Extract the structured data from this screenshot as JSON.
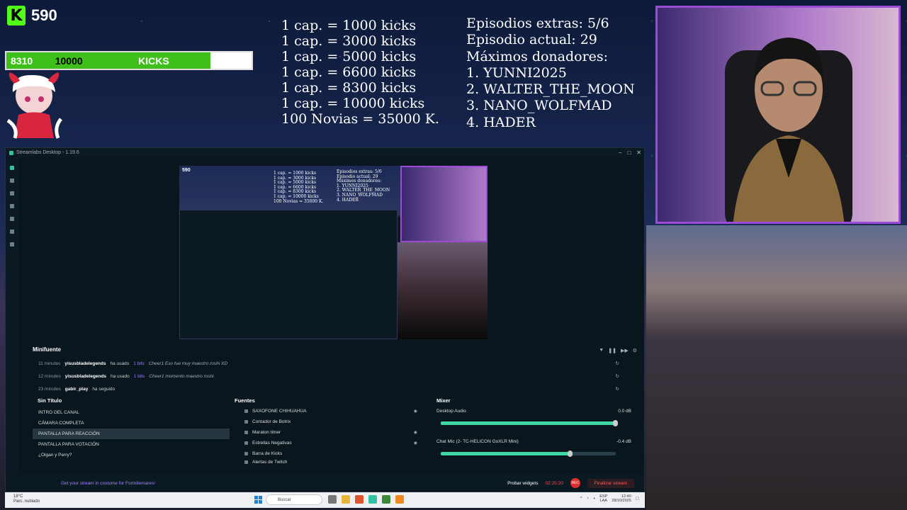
{
  "overlay": {
    "kick_count": "590",
    "kicks_bar": {
      "current": "8310",
      "label": "KICKS",
      "goal": "10000",
      "progress": 0.831
    },
    "rates": [
      "1 cap. = 1000 kicks",
      "1 cap. = 3000 kicks",
      "1 cap. = 5000 kicks",
      "1 cap. = 6600 kicks",
      "1 cap. = 8300 kicks",
      "1 cap. = 10000 kicks",
      "100 Novias = 35000 K."
    ],
    "episodes": [
      "Episodios extras: 5/6",
      "Episodio actual: 29",
      "Máximos donadores:",
      "1. YUNNI2025",
      "2. WALTER_THE_MOON",
      "3. NANO_WOLFMAD",
      "4. HADER"
    ]
  },
  "window": {
    "title": "Streamlabs Desktop - 1.19.6"
  },
  "preview": {
    "kick_count": "590",
    "rates": [
      "1 cap. = 1000 kicks",
      "1 cap. = 3000 kicks",
      "1 cap. = 5000 kicks",
      "1 cap. = 6600 kicks",
      "1 cap. = 8300 kicks",
      "1 cap. = 10000 kicks",
      "100 Novias = 35000 K."
    ],
    "episodes": [
      "Episodios extras: 5/6",
      "Episodio actual: 29",
      "Máximos donadores:",
      "1. YUNNI2025",
      "2. WALTER_THE_MOON",
      "3. NANO_WOLFMAD",
      "4. HADER"
    ]
  },
  "minifeed": {
    "title": "Minifuente",
    "events": [
      {
        "time": "11 minutes",
        "user": "yisusbladelegends",
        "action": "ha usado",
        "bits": "1 bits",
        "msg": "Cheer1 Eso fue muy maestro roshi XD"
      },
      {
        "time": "12 minutes",
        "user": "yisusbladelegends",
        "action": "ha usado",
        "bits": "1 bits",
        "msg": "Cheer1 momento maestro roshi"
      },
      {
        "time": "23 minutes",
        "user": "gabir_play",
        "action": "ha seguido",
        "bits": "",
        "msg": ""
      }
    ]
  },
  "scenes": {
    "title": "Sin Título",
    "items": [
      "INTRO DEL CANAL",
      "CÁMARA COMPLETA",
      "PANTALLA PARA REACCIÓN",
      "PANTALLA PARA VOTACIÓN",
      "¿Oigan y Perry?"
    ],
    "selected": 2
  },
  "sources": {
    "title": "Fuentes",
    "items": [
      "SAXOFONE CHIHUAHUA",
      "Contador de Botrix",
      "Maraton timer",
      "Estrellas Negativas",
      "Barra de Kicks",
      "Alertas de Twitch"
    ]
  },
  "mixer": {
    "title": "Mixer",
    "channels": [
      {
        "name": "Desktop Audio",
        "db": "0.0 dB",
        "level": 1.0
      },
      {
        "name": "Chat Mic (2- TC-HELICON GoXLR Mini)",
        "db": "-0.4 dB",
        "level": 0.74
      }
    ]
  },
  "footer": {
    "message": "Get your stream in costume for Fortnitemares!",
    "test_widgets": "Probar widgets",
    "time": "02:25:20",
    "rec": "REC",
    "end_stream": "Finalizar stream"
  },
  "taskbar": {
    "temp": "18°C",
    "weather": "Parc. nublado",
    "search": "Buscar",
    "lang": "ESP",
    "region": "LAA",
    "time": "12:40",
    "date": "28/10/2025"
  }
}
